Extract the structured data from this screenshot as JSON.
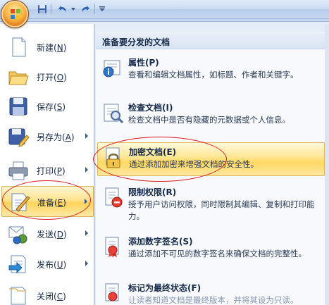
{
  "menu": {
    "left_items": [
      {
        "label": "新建",
        "key": "N",
        "icon": "new-document-icon",
        "submenu": false
      },
      {
        "label": "打开",
        "key": "O",
        "icon": "open-folder-icon",
        "submenu": false
      },
      {
        "label": "保存",
        "key": "S",
        "icon": "save-disk-icon",
        "submenu": false
      },
      {
        "label": "另存为",
        "key": "A",
        "icon": "save-as-icon",
        "submenu": true
      },
      {
        "label": "打印",
        "key": "P",
        "icon": "printer-icon",
        "submenu": true
      },
      {
        "label": "准备",
        "key": "E",
        "icon": "prepare-icon",
        "submenu": true,
        "active": true
      },
      {
        "label": "发送",
        "key": "D",
        "icon": "send-icon",
        "submenu": true
      },
      {
        "label": "发布",
        "key": "U",
        "icon": "publish-icon",
        "submenu": true
      },
      {
        "label": "关闭",
        "key": "C",
        "icon": "close-doc-icon",
        "submenu": false
      }
    ]
  },
  "panel": {
    "header": "准备要分发的文档",
    "items": [
      {
        "title": "属性(P)",
        "desc": "查看和编辑文档属性，如标题、作者和关键字。",
        "icon": "properties-icon"
      },
      {
        "title": "检查文档(I)",
        "desc": "检查文档中是否有隐藏的元数据或个人信息。",
        "icon": "inspect-document-icon"
      },
      {
        "title": "加密文档(E)",
        "desc": "通过添加加密来增强文档的安全性。",
        "icon": "encrypt-lock-icon",
        "active": true
      },
      {
        "title": "限制权限(R)",
        "desc": "授予用户访问权限，同时限制其编辑、复制和打印能力。",
        "icon": "restrict-permission-icon"
      },
      {
        "title": "添加数字签名(S)",
        "desc": "通过添加不可见的数字签名来确保文档的完整性。",
        "icon": "digital-signature-icon"
      },
      {
        "title": "标记为最终状态(F)",
        "desc": "让读者知道文档是最终版本，并将其设为只读。",
        "icon": "mark-final-icon"
      }
    ]
  },
  "colors": {
    "highlight": "#ffd35a",
    "annotation": "#e0191c",
    "text": "#15294a"
  }
}
